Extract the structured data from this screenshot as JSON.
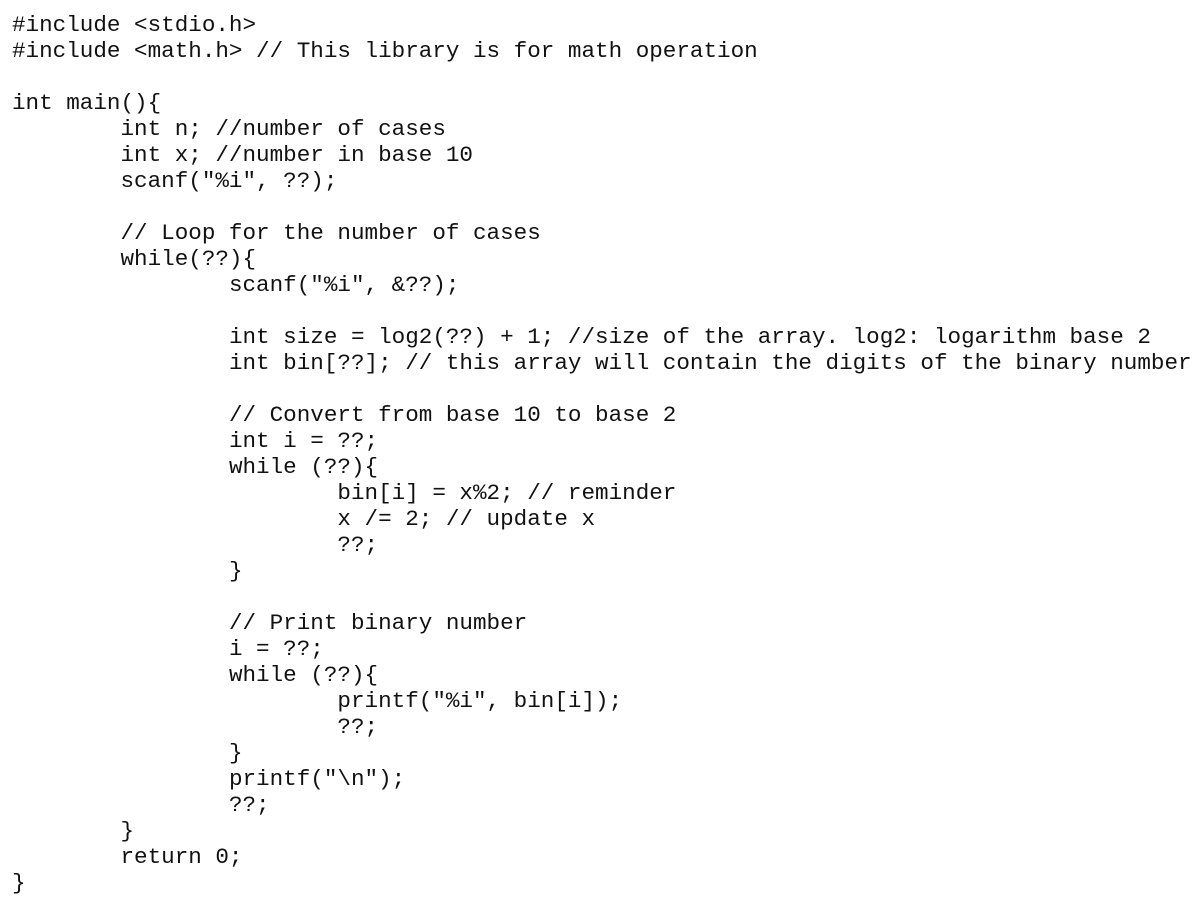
{
  "document": {
    "language": "C",
    "lines": [
      {
        "indent": 0,
        "text": "#include <stdio.h>"
      },
      {
        "indent": 0,
        "text": "#include <math.h> // This library is for math operation"
      },
      {
        "indent": 0,
        "text": ""
      },
      {
        "indent": 0,
        "text": "int main(){"
      },
      {
        "indent": 1,
        "text": "int n; //number of cases"
      },
      {
        "indent": 1,
        "text": "int x; //number in base 10"
      },
      {
        "indent": 1,
        "text": "scanf(\"%i\", ??);"
      },
      {
        "indent": 0,
        "text": ""
      },
      {
        "indent": 1,
        "text": "// Loop for the number of cases"
      },
      {
        "indent": 1,
        "text": "while(??){"
      },
      {
        "indent": 2,
        "text": "scanf(\"%i\", &??);"
      },
      {
        "indent": 0,
        "text": ""
      },
      {
        "indent": 2,
        "text": "int size = log2(??) + 1; //size of the array. log2: logarithm base 2"
      },
      {
        "indent": 2,
        "text": "int bin[??]; // this array will contain the digits of the binary number"
      },
      {
        "indent": 0,
        "text": ""
      },
      {
        "indent": 2,
        "text": "// Convert from base 10 to base 2"
      },
      {
        "indent": 2,
        "text": "int i = ??;"
      },
      {
        "indent": 2,
        "text": "while (??){"
      },
      {
        "indent": 3,
        "text": "bin[i] = x%2; // reminder"
      },
      {
        "indent": 3,
        "text": "x /= 2; // update x"
      },
      {
        "indent": 3,
        "text": "??;"
      },
      {
        "indent": 2,
        "text": "}"
      },
      {
        "indent": 0,
        "text": ""
      },
      {
        "indent": 2,
        "text": "// Print binary number"
      },
      {
        "indent": 2,
        "text": "i = ??;"
      },
      {
        "indent": 2,
        "text": "while (??){"
      },
      {
        "indent": 3,
        "text": "printf(\"%i\", bin[i]);"
      },
      {
        "indent": 3,
        "text": "??;"
      },
      {
        "indent": 2,
        "text": "}"
      },
      {
        "indent": 2,
        "text": "printf(\"\\n\");"
      },
      {
        "indent": 2,
        "text": "??;"
      },
      {
        "indent": 1,
        "text": "}"
      },
      {
        "indent": 1,
        "text": "return 0;"
      },
      {
        "indent": 0,
        "text": "}"
      }
    ]
  }
}
